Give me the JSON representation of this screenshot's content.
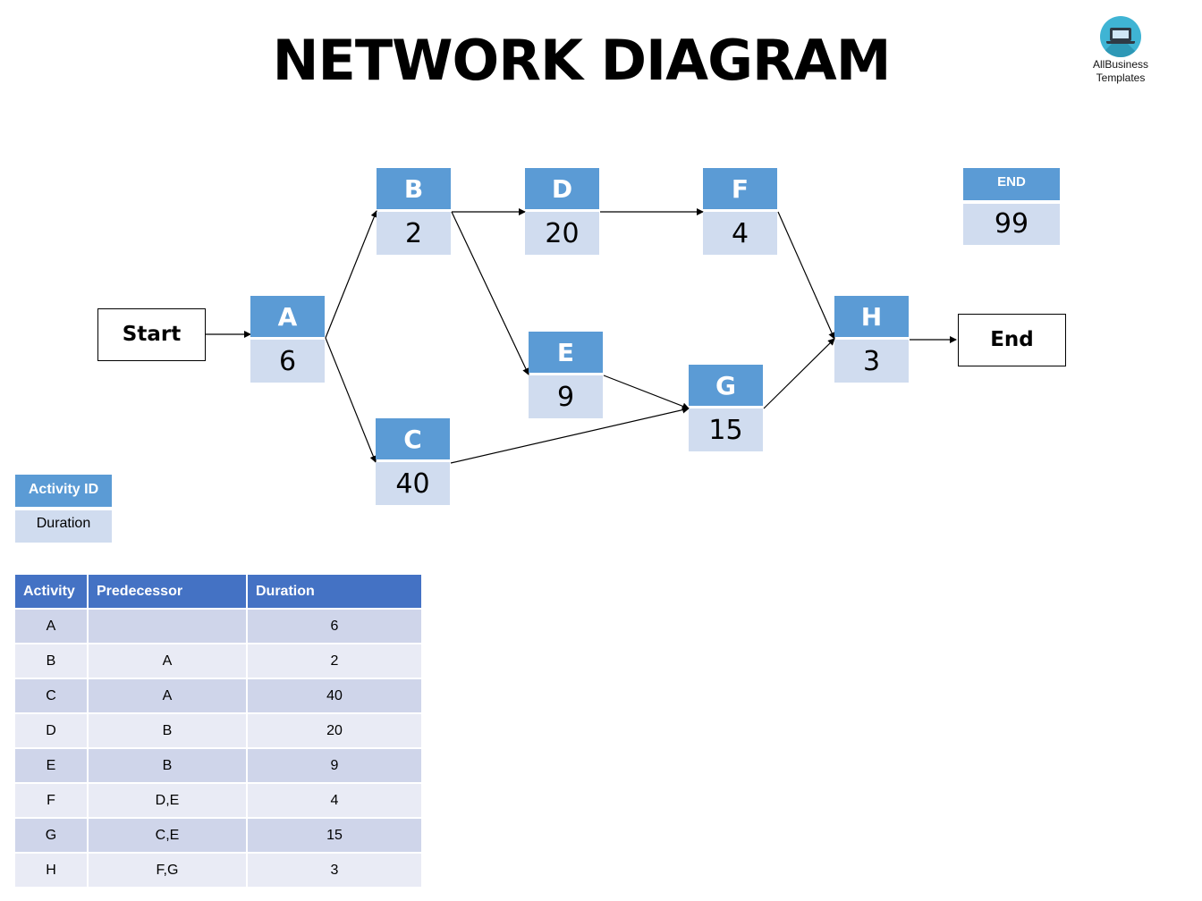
{
  "title": "NETWORK DIAGRAM",
  "logo": {
    "icon": "laptop-icon",
    "line1": "AllBusiness",
    "line2": "Templates"
  },
  "terminals": {
    "start": "Start",
    "end": "End"
  },
  "nodes": [
    {
      "id": "A",
      "duration": "6"
    },
    {
      "id": "B",
      "duration": "2"
    },
    {
      "id": "C",
      "duration": "40"
    },
    {
      "id": "D",
      "duration": "20"
    },
    {
      "id": "E",
      "duration": "9"
    },
    {
      "id": "F",
      "duration": "4"
    },
    {
      "id": "G",
      "duration": "15"
    },
    {
      "id": "H",
      "duration": "3"
    }
  ],
  "edges": [
    [
      "Start",
      "A"
    ],
    [
      "A",
      "B"
    ],
    [
      "A",
      "C"
    ],
    [
      "B",
      "D"
    ],
    [
      "B",
      "E"
    ],
    [
      "D",
      "F"
    ],
    [
      "E",
      "G"
    ],
    [
      "C",
      "G"
    ],
    [
      "F",
      "H"
    ],
    [
      "G",
      "H"
    ],
    [
      "H",
      "End"
    ]
  ],
  "end_summary": {
    "label": "END",
    "value": "99"
  },
  "legend": {
    "header": "Activity ID",
    "body": "Duration"
  },
  "table": {
    "headers": [
      "Activity",
      "Predecessor",
      "Duration"
    ],
    "rows": [
      [
        "A",
        "",
        "6"
      ],
      [
        "B",
        "A",
        "2"
      ],
      [
        "C",
        "A",
        "40"
      ],
      [
        "D",
        "B",
        "20"
      ],
      [
        "E",
        "B",
        "9"
      ],
      [
        "F",
        "D,E",
        "4"
      ],
      [
        "G",
        "C,E",
        "15"
      ],
      [
        "H",
        "F,G",
        "3"
      ]
    ]
  },
  "colors": {
    "node_header": "#5b9bd5",
    "node_body": "#d0dcef",
    "table_header": "#4472c4",
    "table_row_odd": "#cfd5ea",
    "table_row_even": "#e9ebf5"
  }
}
